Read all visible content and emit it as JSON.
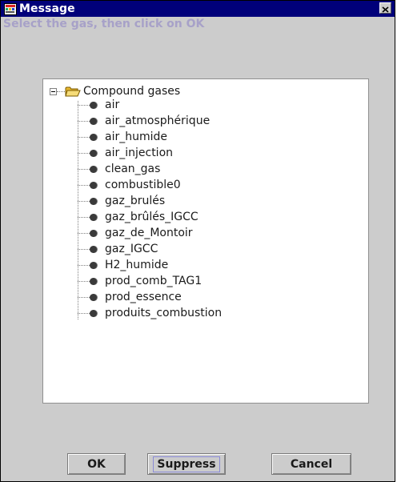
{
  "window": {
    "title": "Message",
    "titlebar_color": "#00007a",
    "icons": {
      "app": "app-icon",
      "close": "close-icon"
    }
  },
  "prompt": "Select the gas, then click on OK",
  "tree": {
    "root_label": "Compound gases",
    "root_icon": "folder-open-icon",
    "expanded": true,
    "items": [
      "air",
      "air_atmosphérique",
      "air_humide",
      "air_injection",
      "clean_gas",
      "combustible0",
      "gaz_brulés",
      "gaz_brûlés_IGCC",
      "gaz_de_Montoir",
      "gaz_IGCC",
      "H2_humide",
      "prod_comb_TAG1",
      "prod_essence",
      "produits_combustion"
    ]
  },
  "buttons": {
    "ok": "OK",
    "suppress": "Suppress",
    "cancel": "Cancel"
  },
  "colors": {
    "dialog_background": "#cccccc",
    "prompt_text": "#a7a1c8"
  }
}
